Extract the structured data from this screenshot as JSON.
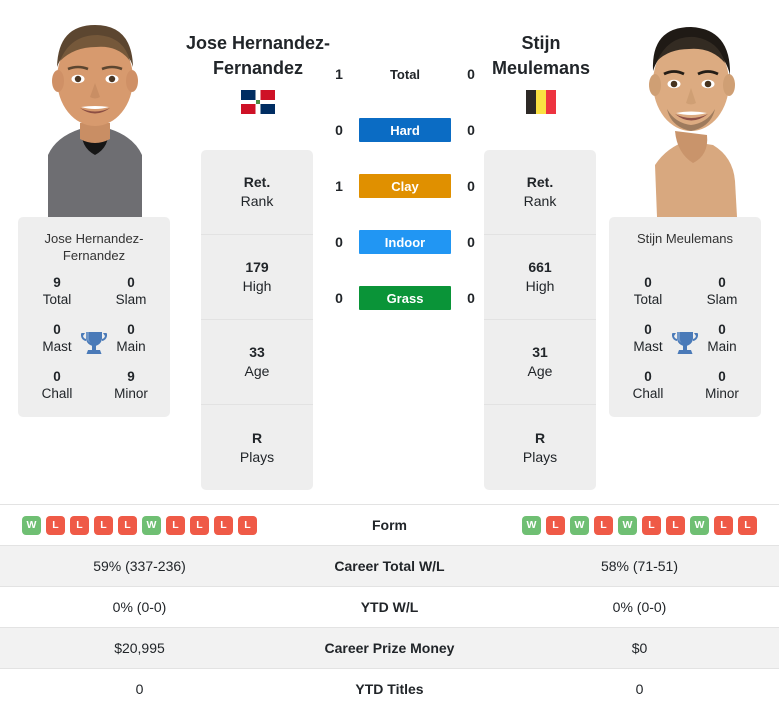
{
  "players": {
    "left": {
      "display_name_line1": "Jose Hernandez-",
      "display_name_line2": "Fernandez",
      "card_name": "Jose Hernandez-Fernandez",
      "flag": "dominican-republic-flag",
      "titles": {
        "total": "9",
        "total_label": "Total",
        "slam": "0",
        "slam_label": "Slam",
        "mast": "0",
        "mast_label": "Mast",
        "main": "0",
        "main_label": "Main",
        "chall": "0",
        "chall_label": "Chall",
        "minor": "9",
        "minor_label": "Minor"
      },
      "stats": [
        {
          "value": "Ret.",
          "label": "Rank"
        },
        {
          "value": "179",
          "label": "High"
        },
        {
          "value": "33",
          "label": "Age"
        },
        {
          "value": "R",
          "label": "Plays"
        }
      ],
      "form": [
        "W",
        "L",
        "L",
        "L",
        "L",
        "W",
        "L",
        "L",
        "L",
        "L"
      ],
      "career_wl": "59% (337-236)",
      "ytd_wl": "0% (0-0)",
      "prize_money": "$20,995",
      "ytd_titles": "0"
    },
    "right": {
      "display_name_line1": "Stijn",
      "display_name_line2": "Meulemans",
      "card_name": "Stijn Meulemans",
      "flag": "belgium-flag",
      "titles": {
        "total": "0",
        "total_label": "Total",
        "slam": "0",
        "slam_label": "Slam",
        "mast": "0",
        "mast_label": "Mast",
        "main": "0",
        "main_label": "Main",
        "chall": "0",
        "chall_label": "Chall",
        "minor": "0",
        "minor_label": "Minor"
      },
      "stats": [
        {
          "value": "Ret.",
          "label": "Rank"
        },
        {
          "value": "661",
          "label": "High"
        },
        {
          "value": "31",
          "label": "Age"
        },
        {
          "value": "R",
          "label": "Plays"
        }
      ],
      "form": [
        "W",
        "L",
        "W",
        "L",
        "W",
        "L",
        "L",
        "W",
        "L",
        "L"
      ],
      "career_wl": "58% (71-51)",
      "ytd_wl": "0% (0-0)",
      "prize_money": "$0",
      "ytd_titles": "0"
    }
  },
  "h2h": {
    "rows": [
      {
        "label": "Total",
        "left": "1",
        "right": "0",
        "color": "",
        "plain": true
      },
      {
        "label": "Hard",
        "left": "0",
        "right": "0",
        "color": "#0b6cc4",
        "plain": false
      },
      {
        "label": "Clay",
        "left": "1",
        "right": "0",
        "color": "#e09000",
        "plain": false
      },
      {
        "label": "Indoor",
        "left": "0",
        "right": "0",
        "color": "#2196f3",
        "plain": false
      },
      {
        "label": "Grass",
        "left": "0",
        "right": "0",
        "color": "#0a9438",
        "plain": false
      }
    ]
  },
  "table": {
    "rows": [
      {
        "key": "form",
        "label": "Form",
        "type": "form",
        "shaded": false
      },
      {
        "key": "career_wl",
        "label": "Career Total W/L",
        "type": "text",
        "shaded": true
      },
      {
        "key": "ytd_wl",
        "label": "YTD W/L",
        "type": "text",
        "shaded": false
      },
      {
        "key": "prize_money",
        "label": "Career Prize Money",
        "type": "text",
        "shaded": true
      },
      {
        "key": "ytd_titles",
        "label": "YTD Titles",
        "type": "text",
        "shaded": false
      }
    ]
  },
  "icons": {
    "trophy": "trophy-icon"
  },
  "colors": {
    "hard": "#0b6cc4",
    "clay": "#e09000",
    "indoor": "#2196f3",
    "grass": "#0a9438",
    "win": "#6fbf73",
    "loss": "#ef5a47",
    "card_bg": "#eeeeee",
    "row_shade": "#f2f2f2",
    "trophy": "#4a7ab8"
  }
}
